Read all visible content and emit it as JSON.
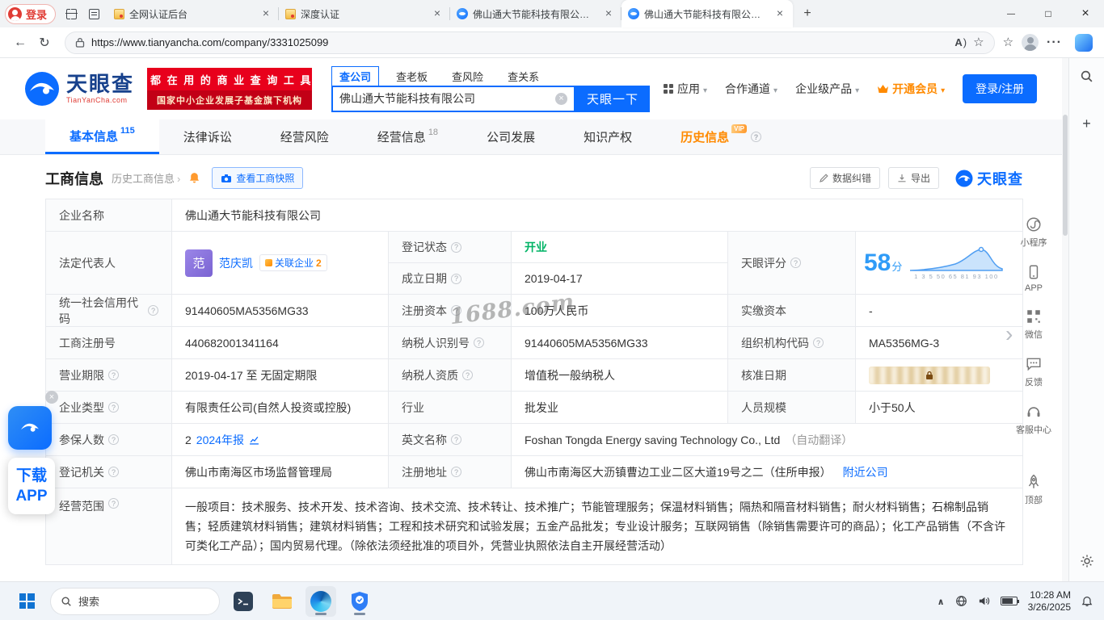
{
  "chrome": {
    "login_label": "登录",
    "tab1": "全网认证后台",
    "tab2": "深度认证",
    "tab3": "佛山通大节能科技有限公司_相关",
    "tab4": "佛山通大节能科技有限公司 - 天眼",
    "url": "https://www.tianyancha.com/company/3331025099"
  },
  "header": {
    "logo_text": "天眼查",
    "logo_sub": "TianYanCha.com",
    "banner_line1": "都 在 用 的 商 业 查 询 工 具",
    "banner_line2": "国家中小企业发展子基金旗下机构",
    "tab_company": "查公司",
    "tab_boss": "查老板",
    "tab_risk": "查风险",
    "tab_relation": "查关系",
    "search_value": "佛山通大节能科技有限公司",
    "search_button": "天眼一下",
    "nav_app": "应用",
    "nav_coop": "合作通道",
    "nav_enterprise": "企业级产品",
    "nav_vip": "开通会员",
    "nav_login": "登录/注册"
  },
  "tabs": {
    "basic": "基本信息",
    "basic_count": "115",
    "legal": "法律诉讼",
    "risk": "经营风险",
    "operation": "经营信息",
    "operation_count": "18",
    "development": "公司发展",
    "ip": "知识产权",
    "history": "历史信息",
    "history_vip": "VIP"
  },
  "section": {
    "title": "工商信息",
    "history_link": "历史工商信息",
    "snapshot": "查看工商快照",
    "correction": "数据纠错",
    "export": "导出",
    "brand": "天眼查"
  },
  "info": {
    "watermark": "1688.com",
    "name_label": "企业名称",
    "name": "佛山通大节能科技有限公司",
    "legal_label": "法定代表人",
    "legal_avatar": "范",
    "legal_name": "范庆凯",
    "related_label": "关联企业",
    "related_count": "2",
    "status_label": "登记状态",
    "status": "开业",
    "establish_label": "成立日期",
    "establish": "2019-04-17",
    "score_label": "天眼评分",
    "score": "58",
    "score_unit": "分",
    "score_axis": "1 3 5 50 65 81 93 100",
    "credit_label": "统一社会信用代码",
    "credit_code": "91440605MA5356MG33",
    "capital_label": "注册资本",
    "capital": "100万人民币",
    "paid_label": "实缴资本",
    "paid": "-",
    "regno_label": "工商注册号",
    "regno": "440682001341164",
    "taxno_label": "纳税人识别号",
    "taxno": "91440605MA5356MG33",
    "orgcode_label": "组织机构代码",
    "orgcode": "MA5356MG-3",
    "term_label": "营业期限",
    "term": "2019-04-17 至 无固定期限",
    "taxpayer_label": "纳税人资质",
    "taxpayer": "增值税一般纳税人",
    "approve_label": "核准日期",
    "type_label": "企业类型",
    "type": "有限责任公司(自然人投资或控股)",
    "industry_label": "行业",
    "industry": "批发业",
    "staff_label": "人员规模",
    "staff": "小于50人",
    "insured_label": "参保人数",
    "insured": "2",
    "annual_report": "2024年报",
    "en_label": "英文名称",
    "en_name": "Foshan Tongda Energy saving Technology Co., Ltd",
    "en_note": "（自动翻译）",
    "registry_label": "登记机关",
    "registry": "佛山市南海区市场监督管理局",
    "address_label": "注册地址",
    "address": "佛山市南海区大沥镇曹边工业二区大道19号之二（住所申报）",
    "nearby": "附近公司",
    "scope_label": "经营范围",
    "scope": "一般项目：技术服务、技术开发、技术咨询、技术交流、技术转让、技术推广；节能管理服务；保温材料销售；隔热和隔音材料销售；耐火材料销售；石棉制品销售；轻质建筑材料销售；建筑材料销售；工程和技术研究和试验发展；五金产品批发；专业设计服务；互联网销售（除销售需要许可的商品）；化工产品销售（不含许可类化工产品）；国内贸易代理。（除依法须经批准的项目外，凭营业执照依法自主开展经营活动）"
  },
  "floats": {
    "download_line1": "下载",
    "download_line2": "APP",
    "mini": "小程序",
    "app": "APP",
    "wechat": "微信",
    "feedback": "反馈",
    "service": "客服中心",
    "top": "顶部"
  },
  "taskbar": {
    "search": "搜索",
    "time": "10:28 AM",
    "date": "3/26/2025"
  }
}
